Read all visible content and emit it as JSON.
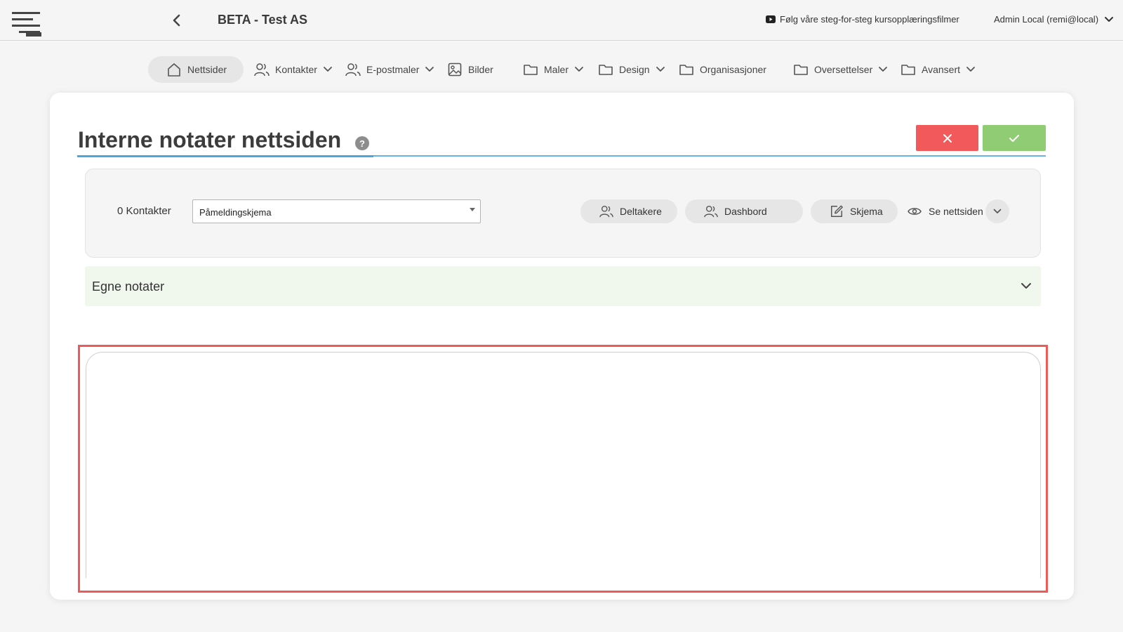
{
  "header": {
    "app_title": "BETA - Test AS",
    "tutorial_link": "Følg våre steg-for-steg kursopplæringsfilmer",
    "user_label": "Admin Local (remi@local)"
  },
  "nav": {
    "items": [
      {
        "label": "Nettsider",
        "icon": "home-icon",
        "active": true
      },
      {
        "label": "Kontakter",
        "icon": "users-icon",
        "dropdown": true
      },
      {
        "label": "E-postmaler",
        "icon": "users-icon",
        "dropdown": true
      },
      {
        "label": "Bilder",
        "icon": "image-icon"
      },
      {
        "label": "Maler",
        "icon": "folder-icon",
        "dropdown": true
      },
      {
        "label": "Design",
        "icon": "folder-icon",
        "dropdown": true
      },
      {
        "label": "Organisasjoner",
        "icon": "folder-icon"
      },
      {
        "label": "Oversettelser",
        "icon": "folder-icon",
        "dropdown": true
      },
      {
        "label": "Avansert",
        "icon": "folder-icon",
        "dropdown": true
      }
    ]
  },
  "page": {
    "title": "Interne notater nettsiden",
    "help": "?"
  },
  "toolbar": {
    "contacts_count": "0 Kontakter",
    "form_select_value": "Påmeldingskjema",
    "participants": "Deltakere",
    "dashboard": "Dashbord",
    "form": "Skjema",
    "view_site": "Se nettsiden"
  },
  "notes": {
    "title": "Egne notater"
  },
  "colors": {
    "cancel": "#f2595a",
    "confirm": "#8fcc73",
    "accent_line": "#64b6e0",
    "accordion_bg": "#f0f7ec",
    "highlight": "#ec5a5a"
  }
}
